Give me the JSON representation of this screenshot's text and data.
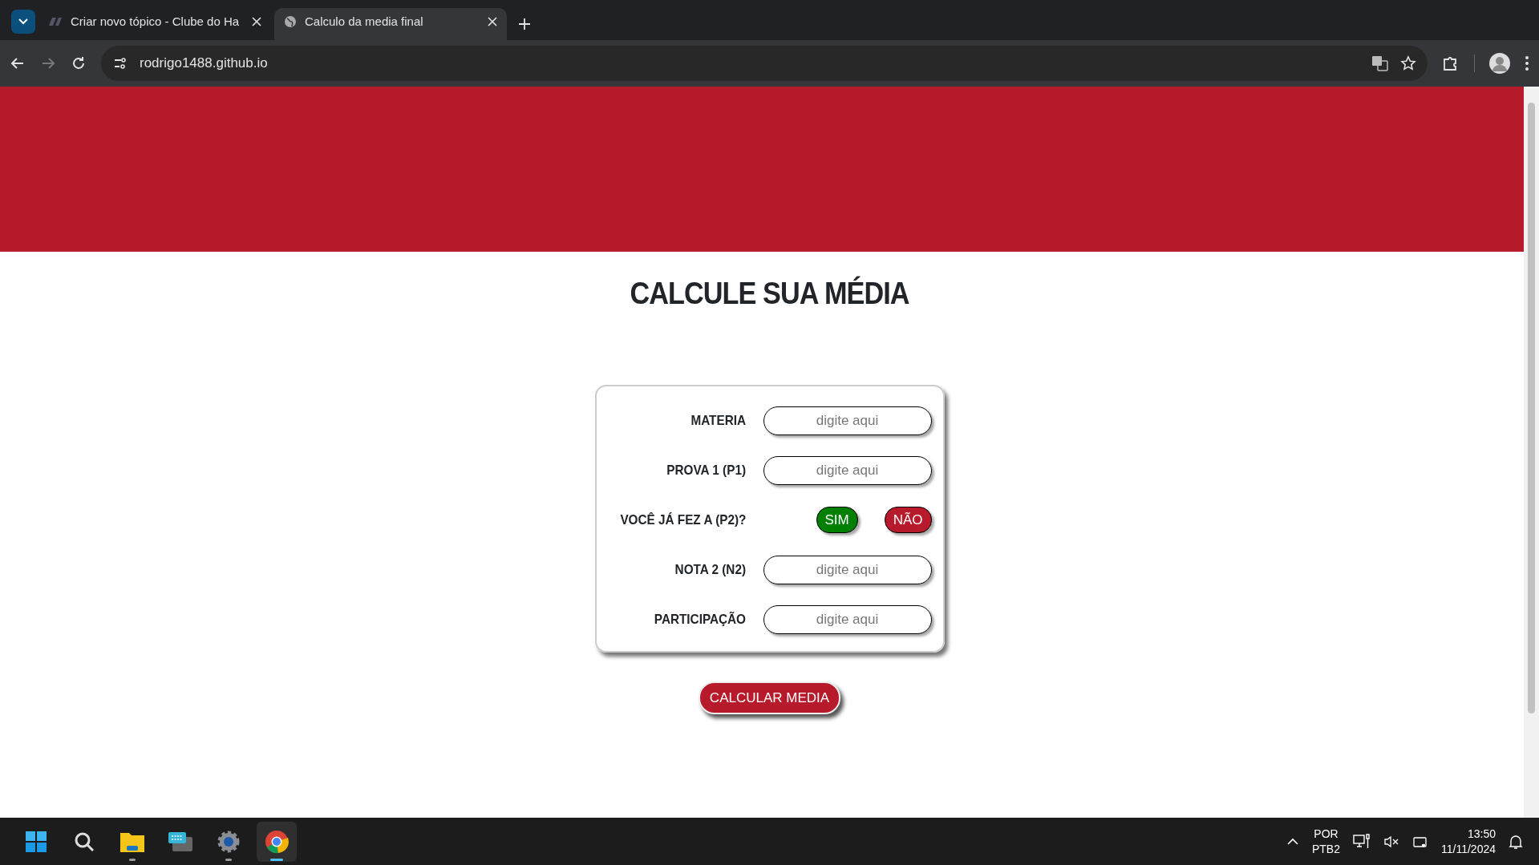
{
  "browser": {
    "tabs": [
      {
        "title": "Criar novo tópico - Clube do Ha",
        "selected": false
      },
      {
        "title": "Calculo da media final",
        "selected": true
      }
    ],
    "url": "rodrigo1488.github.io"
  },
  "page": {
    "heading": "CALCULE SUA MÉDIA",
    "form": [
      {
        "kind": "input",
        "label": "MATERIA",
        "placeholder": "digite aqui"
      },
      {
        "kind": "input",
        "label": "PROVA 1 (P1)",
        "placeholder": "digite aqui"
      },
      {
        "kind": "choice",
        "label": "VOCÊ JÁ FEZ A (P2)?",
        "options": [
          {
            "label": "SIM",
            "color": "#008000"
          },
          {
            "label": "NÃO",
            "color": "#b71a2a"
          }
        ]
      },
      {
        "kind": "input",
        "label": "NOTA 2 (N2)",
        "placeholder": "digite aqui"
      },
      {
        "kind": "input",
        "label": "PARTICIPAÇÃO",
        "placeholder": "digite aqui"
      }
    ],
    "submit": "CALCULAR MEDIA"
  },
  "taskbar": {
    "apps": [
      {
        "kind": "start",
        "running": false,
        "selected": false
      },
      {
        "kind": "search",
        "running": false,
        "selected": false
      },
      {
        "kind": "folder",
        "running": true,
        "selected": false
      },
      {
        "kind": "keyboard",
        "running": false,
        "selected": false
      },
      {
        "kind": "gear",
        "running": true,
        "selected": false
      },
      {
        "kind": "chrome",
        "running": true,
        "selected": true
      }
    ],
    "language": "POR",
    "layout": "PTB2",
    "time": "13:50",
    "date": "11/11/2024"
  }
}
